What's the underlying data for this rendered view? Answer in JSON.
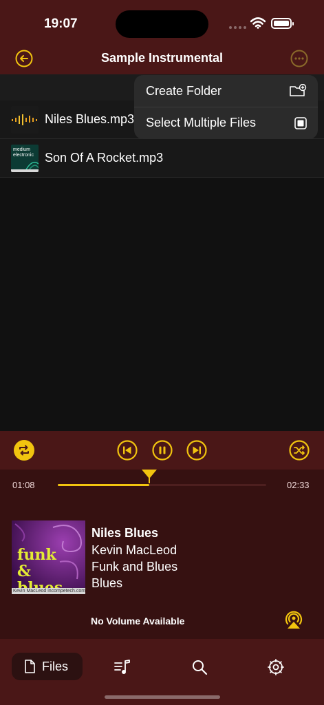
{
  "status": {
    "time": "19:07"
  },
  "nav": {
    "title": "Sample Instrumental"
  },
  "files": [
    {
      "name": "Niles Blues.mp3",
      "thumb": "waveform-thumb"
    },
    {
      "name": "Son Of A Rocket.mp3",
      "thumb": "album-thumb",
      "thumb_text_1": "medium",
      "thumb_text_2": "electronic"
    }
  ],
  "menu": {
    "create_folder": "Create Folder",
    "select_multiple": "Select Multiple Files"
  },
  "player": {
    "elapsed": "01:08",
    "duration": "02:33",
    "progress": 0.44,
    "title": "Niles Blues",
    "artist": "Kevin MacLeod",
    "album": "Funk and Blues",
    "genre": "Blues",
    "art_title": "funk & blues",
    "art_credit": "Kevin MacLeod    incompetech.com",
    "volume_text": "No Volume Available"
  },
  "tabs": {
    "files_label": "Files"
  },
  "colors": {
    "accent": "#f1c40f",
    "header": "#4a1717",
    "player_bg": "#361111"
  }
}
